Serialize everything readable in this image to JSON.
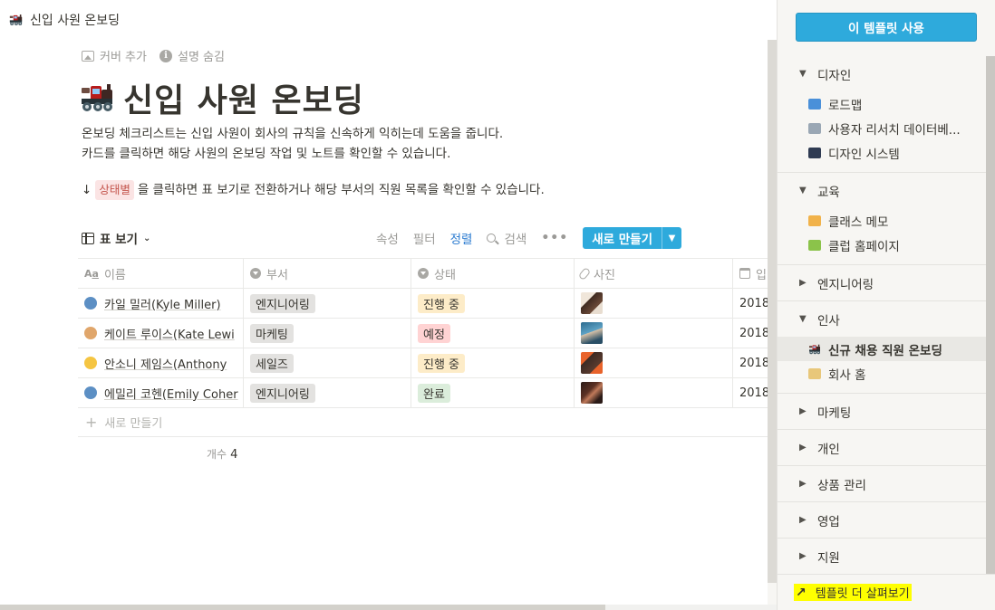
{
  "topbar": {
    "title": "신입 사원 온보딩",
    "emoji": "train-icon"
  },
  "page": {
    "actions": {
      "add_cover": "커버 추가",
      "hide_description": "설명 숨김"
    },
    "title": "신입 사원 온보딩",
    "description_lines": [
      "온보딩 체크리스트는 신입 사원이 회사의 규칙을 신속하게 익히는데 도움을 줍니다.",
      "카드를 클릭하면 해당 사원의 온보딩 작업 및 노트를 확인할 수 있습니다."
    ],
    "hint": {
      "arrow": "↓",
      "tag": "상태별",
      "rest": "을 클릭하면 표 보기로 전환하거나 해당 부서의 직원 목록을 확인할 수 있습니다."
    }
  },
  "view": {
    "selector": "표 보기",
    "properties": "속성",
    "filter": "필터",
    "sort": "정렬",
    "search": "검색",
    "more": "•••",
    "new_button": "새로 만들기"
  },
  "table": {
    "headers": {
      "name": "이름",
      "dept": "부서",
      "status": "상태",
      "photo": "사진",
      "date": "입"
    },
    "rows": [
      {
        "name": "카일 밀러(Kyle Miller)",
        "dept": "엔지니어링",
        "status": "진행 중",
        "date": "2018"
      },
      {
        "name": "케이트 루이스(Kate Lewi",
        "dept": "마케팅",
        "status": "예정",
        "date": "2018"
      },
      {
        "name": "안소니 제임스(Anthony",
        "dept": "세일즈",
        "status": "진행 중",
        "date": "2018"
      },
      {
        "name": "에밀리 코헨(Emily Coher",
        "dept": "엔지니어링",
        "status": "완료",
        "date": "2018"
      }
    ],
    "new_row": "새로 만들기",
    "count_label": "개수",
    "count_value": "4"
  },
  "sidebar": {
    "use_template": "이 템플릿 사용",
    "sections": [
      {
        "label": "디자인",
        "items": [
          "로드맵",
          "사용자 리서치 데이터베...",
          "디자인 시스템"
        ]
      },
      {
        "label": "교육",
        "items": [
          "클래스 메모",
          "클럽 홈페이지"
        ]
      },
      {
        "label": "엔지니어링"
      },
      {
        "label": "인사",
        "items": [
          "신규 채용 직원 온보딩",
          "회사 홈"
        ]
      },
      {
        "label": "마케팅"
      },
      {
        "label": "개인"
      },
      {
        "label": "상품 관리"
      },
      {
        "label": "영업"
      },
      {
        "label": "지원"
      }
    ],
    "footer": "템플릿 더 살펴보기"
  },
  "colors": {
    "accent": "#2eaadc",
    "highlight": "#ffff00"
  }
}
